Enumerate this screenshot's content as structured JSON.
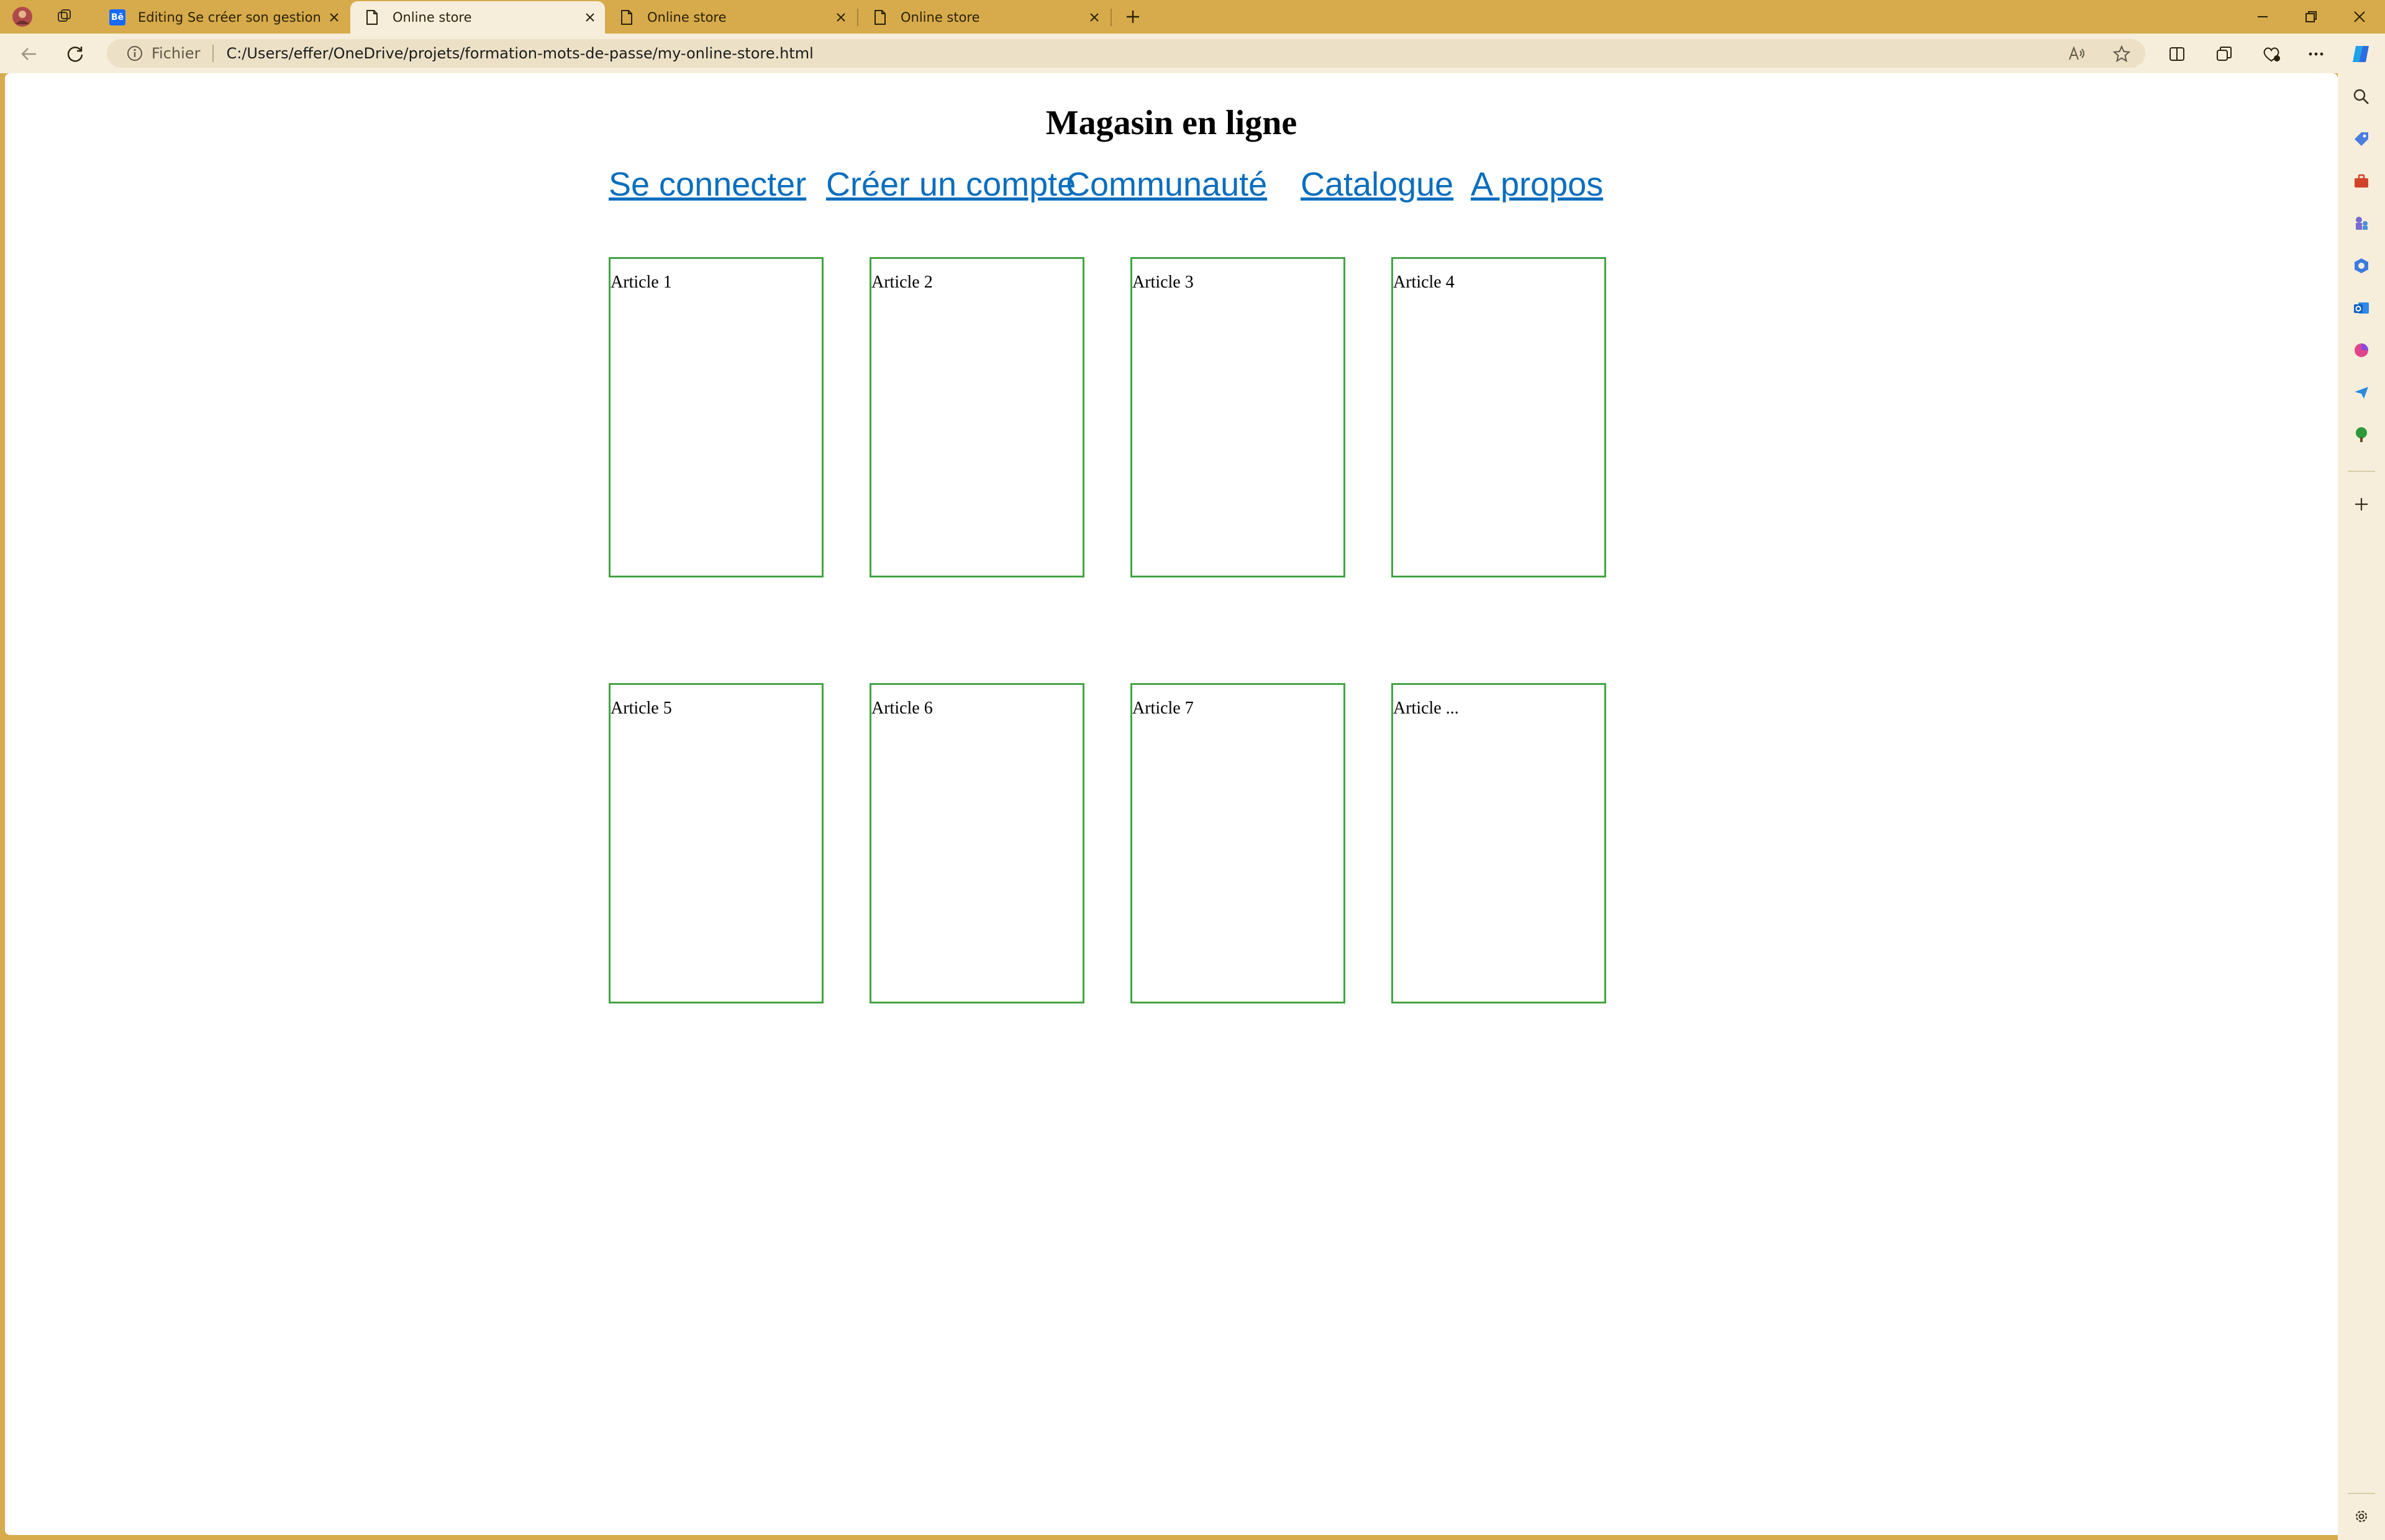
{
  "browser": {
    "tabs": [
      {
        "title": "Editing Se créer son gestionnaire",
        "favicon": "behance-icon",
        "active": false
      },
      {
        "title": "Online store",
        "favicon": "page-icon",
        "active": true
      },
      {
        "title": "Online store",
        "favicon": "page-icon",
        "active": false
      },
      {
        "title": "Online store",
        "favicon": "page-icon",
        "active": false
      }
    ],
    "behance_badge": "Bē",
    "address": {
      "scheme_label": "Fichier",
      "url": "C:/Users/effer/OneDrive/projets/formation-mots-de-passe/my-online-store.html"
    },
    "colors": {
      "frame": "#d7ab4b",
      "toolbar": "#f6eedb",
      "link": "#0a6ebd",
      "card_border": "#44a344"
    }
  },
  "page": {
    "title": "Magasin en ligne",
    "nav": [
      {
        "label": "Se connecter"
      },
      {
        "label": "Créer un compte"
      },
      {
        "label": "Communauté"
      },
      {
        "label": "Catalogue"
      },
      {
        "label": "A propos"
      }
    ],
    "articles": [
      {
        "label": "Article 1"
      },
      {
        "label": "Article 2"
      },
      {
        "label": "Article 3"
      },
      {
        "label": "Article 4"
      },
      {
        "label": "Article 5"
      },
      {
        "label": "Article 6"
      },
      {
        "label": "Article 7"
      },
      {
        "label": "Article ..."
      }
    ]
  }
}
